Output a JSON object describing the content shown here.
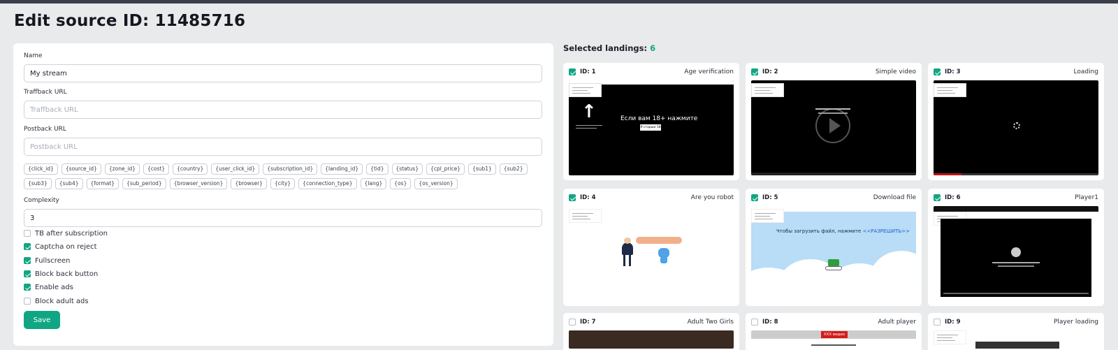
{
  "page": {
    "title": "Edit source ID: 11485716"
  },
  "form": {
    "name_label": "Name",
    "name_value": "My stream",
    "traffback_label": "Traffback URL",
    "traffback_placeholder": "Traffback URL",
    "postback_label": "Postback URL",
    "postback_placeholder": "Postback URL",
    "macros": [
      "{click_id}",
      "{source_id}",
      "{zone_id}",
      "{cost}",
      "{country}",
      "{user_click_id}",
      "{subscription_id}",
      "{landing_id}",
      "{tid}",
      "{status}",
      "{cpl_price}",
      "{sub1}",
      "{sub2}",
      "{sub3}",
      "{sub4}",
      "{format}",
      "{sub_period}",
      "{browser_version}",
      "{browser}",
      "{city}",
      "{connection_type}",
      "{lang}",
      "{os}",
      "{os_version}"
    ],
    "complexity_label": "Complexity",
    "complexity_value": "3",
    "options": [
      {
        "label": "TB after subscription",
        "checked": false
      },
      {
        "label": "Captcha on reject",
        "checked": true
      },
      {
        "label": "Fullscreen",
        "checked": true
      },
      {
        "label": "Block back button",
        "checked": true
      },
      {
        "label": "Enable ads",
        "checked": true
      },
      {
        "label": "Block adult ads",
        "checked": false
      }
    ],
    "save_label": "Save"
  },
  "landings": {
    "title": "Selected landings:",
    "count": "6",
    "accent": "#11a683",
    "items": [
      {
        "id": "ID: 1",
        "name": "Age verification",
        "checked": true,
        "preview_text": "Если вам 18+ нажмите",
        "preview_button": "Я старше 18"
      },
      {
        "id": "ID: 2",
        "name": "Simple video",
        "checked": true
      },
      {
        "id": "ID: 3",
        "name": "Loading",
        "checked": true
      },
      {
        "id": "ID: 4",
        "name": "Are you robot",
        "checked": true
      },
      {
        "id": "ID: 5",
        "name": "Download file",
        "checked": true,
        "preview_text": "Чтобы загрузить файл, нажмите",
        "preview_link": "<<РАЗРЕШИТЬ>>"
      },
      {
        "id": "ID: 6",
        "name": "Player1",
        "checked": true
      },
      {
        "id": "ID: 7",
        "name": "Adult Two Girls",
        "checked": false
      },
      {
        "id": "ID: 8",
        "name": "Adult player",
        "checked": false,
        "preview_badge": "XXX видео"
      },
      {
        "id": "ID: 9",
        "name": "Player loading",
        "checked": false
      }
    ]
  }
}
